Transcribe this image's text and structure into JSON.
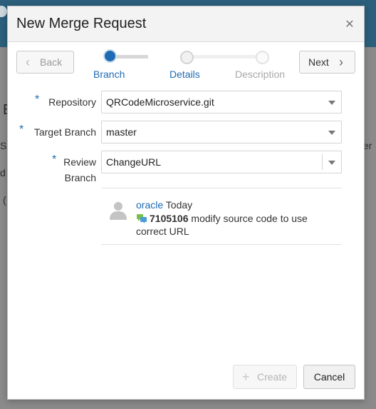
{
  "dialog": {
    "title": "New Merge Request",
    "close_icon": "close-icon"
  },
  "train": {
    "back_label": "Back",
    "next_label": "Next",
    "steps": [
      {
        "label": "Branch",
        "state": "current"
      },
      {
        "label": "Details",
        "state": "next"
      },
      {
        "label": "Description",
        "state": "disabled"
      }
    ]
  },
  "form": {
    "required_marker": "*",
    "repository": {
      "label": "Repository",
      "value": "QRCodeMicroservice.git"
    },
    "target_branch": {
      "label": "Target Branch",
      "value": "master"
    },
    "review_branch": {
      "label_line1": "Review",
      "label_line2": "Branch",
      "value": "ChangeURL"
    }
  },
  "commit": {
    "user": "oracle",
    "time": "Today",
    "id": "7105106",
    "message": "modify source code to use correct URL",
    "avatar_icon": "user-avatar-icon",
    "commit_icon": "commit-comment-icon"
  },
  "footer": {
    "create_label": "Create",
    "cancel_label": "Cancel"
  },
  "background": {
    "fragments": [
      "E",
      "S",
      "d",
      "(",
      "er"
    ]
  },
  "colors": {
    "accent": "#1e6ab3",
    "header_bg": "#f3f3f3",
    "topbar": "#2b5f7c"
  }
}
